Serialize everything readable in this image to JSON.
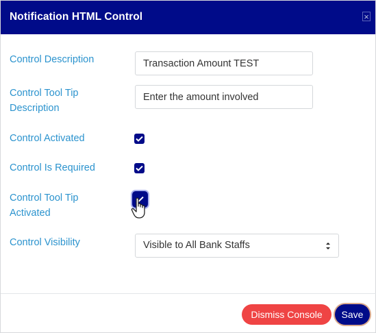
{
  "modal": {
    "title": "Notification HTML Control",
    "close_icon": "close-icon"
  },
  "fields": {
    "description_label": "Control Description",
    "description_value": "Transaction Amount TEST",
    "tooltip_desc_label_line1": "Control Tool Tip",
    "tooltip_desc_label_line2": "Description",
    "tooltip_desc_value": "Enter the amount involved",
    "activated_label": "Control Activated",
    "activated_checked": true,
    "required_label": "Control Is Required",
    "required_checked": true,
    "tooltip_activated_label_line1": "Control Tool Tip",
    "tooltip_activated_label_line2": "Activated",
    "tooltip_activated_checked": true,
    "visibility_label": "Control Visibility",
    "visibility_value": "Visible to All Bank Staffs"
  },
  "buttons": {
    "dismiss": "Dismiss Console",
    "save": "Save"
  },
  "colors": {
    "header_bg": "#000b89",
    "label_color": "#2b93ce",
    "dismiss_bg": "#ef4444",
    "save_bg": "#000b89"
  }
}
